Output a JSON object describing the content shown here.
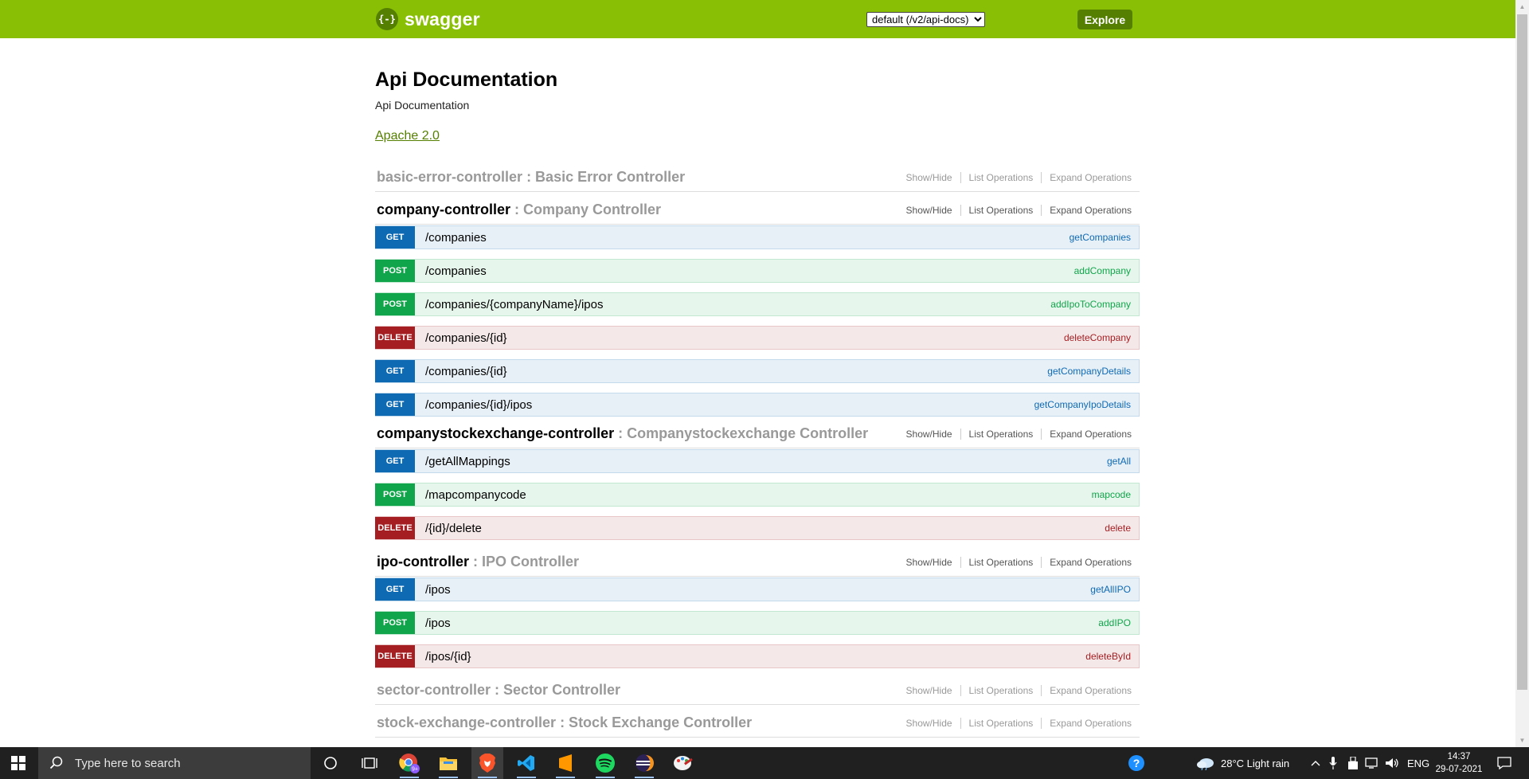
{
  "header": {
    "logo_glyph": "{-}",
    "logo_text": "swagger",
    "api_select_value": "default (/v2/api-docs)",
    "explore_label": "Explore"
  },
  "info": {
    "title": "Api Documentation",
    "description": "Api Documentation",
    "license": "Apache 2.0"
  },
  "options": {
    "show_hide": "Show/Hide",
    "list_ops": "List Operations",
    "expand_ops": "Expand Operations"
  },
  "resources": [
    {
      "name": "basic-error-controller",
      "desc": " : Basic Error Controller",
      "expanded": false,
      "operations": []
    },
    {
      "name": "company-controller",
      "desc": " : Company Controller",
      "expanded": true,
      "operations": [
        {
          "method": "GET",
          "path": "/companies",
          "nickname": "getCompanies"
        },
        {
          "method": "POST",
          "path": "/companies",
          "nickname": "addCompany"
        },
        {
          "method": "POST",
          "path": "/companies/{companyName}/ipos",
          "nickname": "addIpoToCompany"
        },
        {
          "method": "DELETE",
          "path": "/companies/{id}",
          "nickname": "deleteCompany"
        },
        {
          "method": "GET",
          "path": "/companies/{id}",
          "nickname": "getCompanyDetails"
        },
        {
          "method": "GET",
          "path": "/companies/{id}/ipos",
          "nickname": "getCompanyIpoDetails"
        }
      ]
    },
    {
      "name": "companystockexchange-controller",
      "desc": " : Companystockexchange Controller",
      "expanded": true,
      "operations": [
        {
          "method": "GET",
          "path": "/getAllMappings",
          "nickname": "getAll"
        },
        {
          "method": "POST",
          "path": "/mapcompanycode",
          "nickname": "mapcode"
        },
        {
          "method": "DELETE",
          "path": "/{id}/delete",
          "nickname": "delete"
        }
      ]
    },
    {
      "name": "ipo-controller",
      "desc": " : IPO Controller",
      "expanded": true,
      "operations": [
        {
          "method": "GET",
          "path": "/ipos",
          "nickname": "getAllIPO"
        },
        {
          "method": "POST",
          "path": "/ipos",
          "nickname": "addIPO"
        },
        {
          "method": "DELETE",
          "path": "/ipos/{id}",
          "nickname": "deleteById"
        }
      ]
    },
    {
      "name": "sector-controller",
      "desc": " : Sector Controller",
      "expanded": false,
      "operations": []
    },
    {
      "name": "stock-exchange-controller",
      "desc": " : Stock Exchange Controller",
      "expanded": false,
      "operations": []
    }
  ],
  "taskbar": {
    "search_placeholder": "Type here to search",
    "apps": [
      "cortana-icon",
      "task-view-icon",
      "chrome-icon",
      "file-explorer-icon",
      "brave-icon",
      "vscode-icon",
      "sublime-text-icon",
      "spotify-icon",
      "eclipse-icon",
      "paint-icon"
    ],
    "chrome_badge": "9+",
    "weather": "28°C  Light rain",
    "language": "ENG",
    "time": "14:37",
    "date": "29-07-2021"
  },
  "colors": {
    "header_bg": "#89bf04",
    "get": "#0f6ab4",
    "post": "#10a54a",
    "delete": "#a41e22"
  }
}
